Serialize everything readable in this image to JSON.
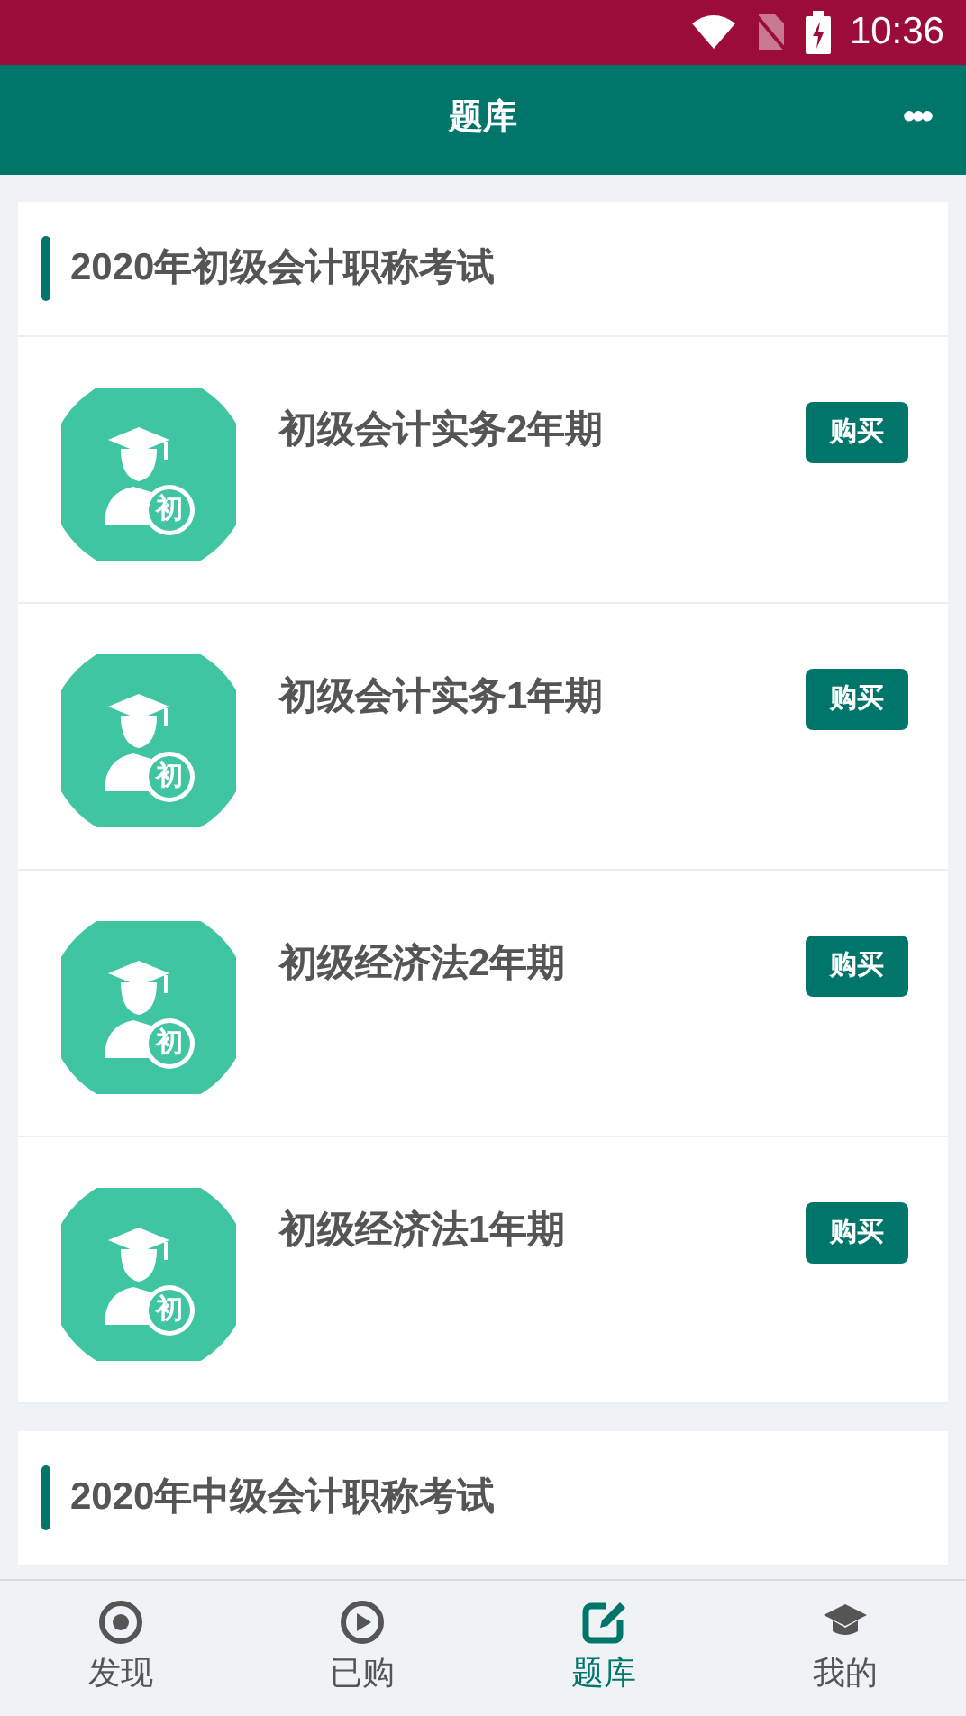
{
  "status_bar": {
    "time": "10:36"
  },
  "header": {
    "title": "题库",
    "menu": "•••"
  },
  "sections": [
    {
      "title": "2020年初级会计职称考试",
      "items": [
        {
          "name": "初级会计实务2年期",
          "badge_char": "初",
          "action": "购买"
        },
        {
          "name": "初级会计实务1年期",
          "badge_char": "初",
          "action": "购买"
        },
        {
          "name": "初级经济法2年期",
          "badge_char": "初",
          "action": "购买"
        },
        {
          "name": "初级经济法1年期",
          "badge_char": "初",
          "action": "购买"
        }
      ]
    },
    {
      "title": "2020年中级会计职称考试"
    }
  ],
  "bottom_nav": [
    {
      "label": "发现",
      "kind": "target",
      "selected": false
    },
    {
      "label": "已购",
      "kind": "play",
      "selected": false
    },
    {
      "label": "题库",
      "kind": "edit",
      "selected": true
    },
    {
      "label": "我的",
      "kind": "cap",
      "selected": false
    }
  ]
}
